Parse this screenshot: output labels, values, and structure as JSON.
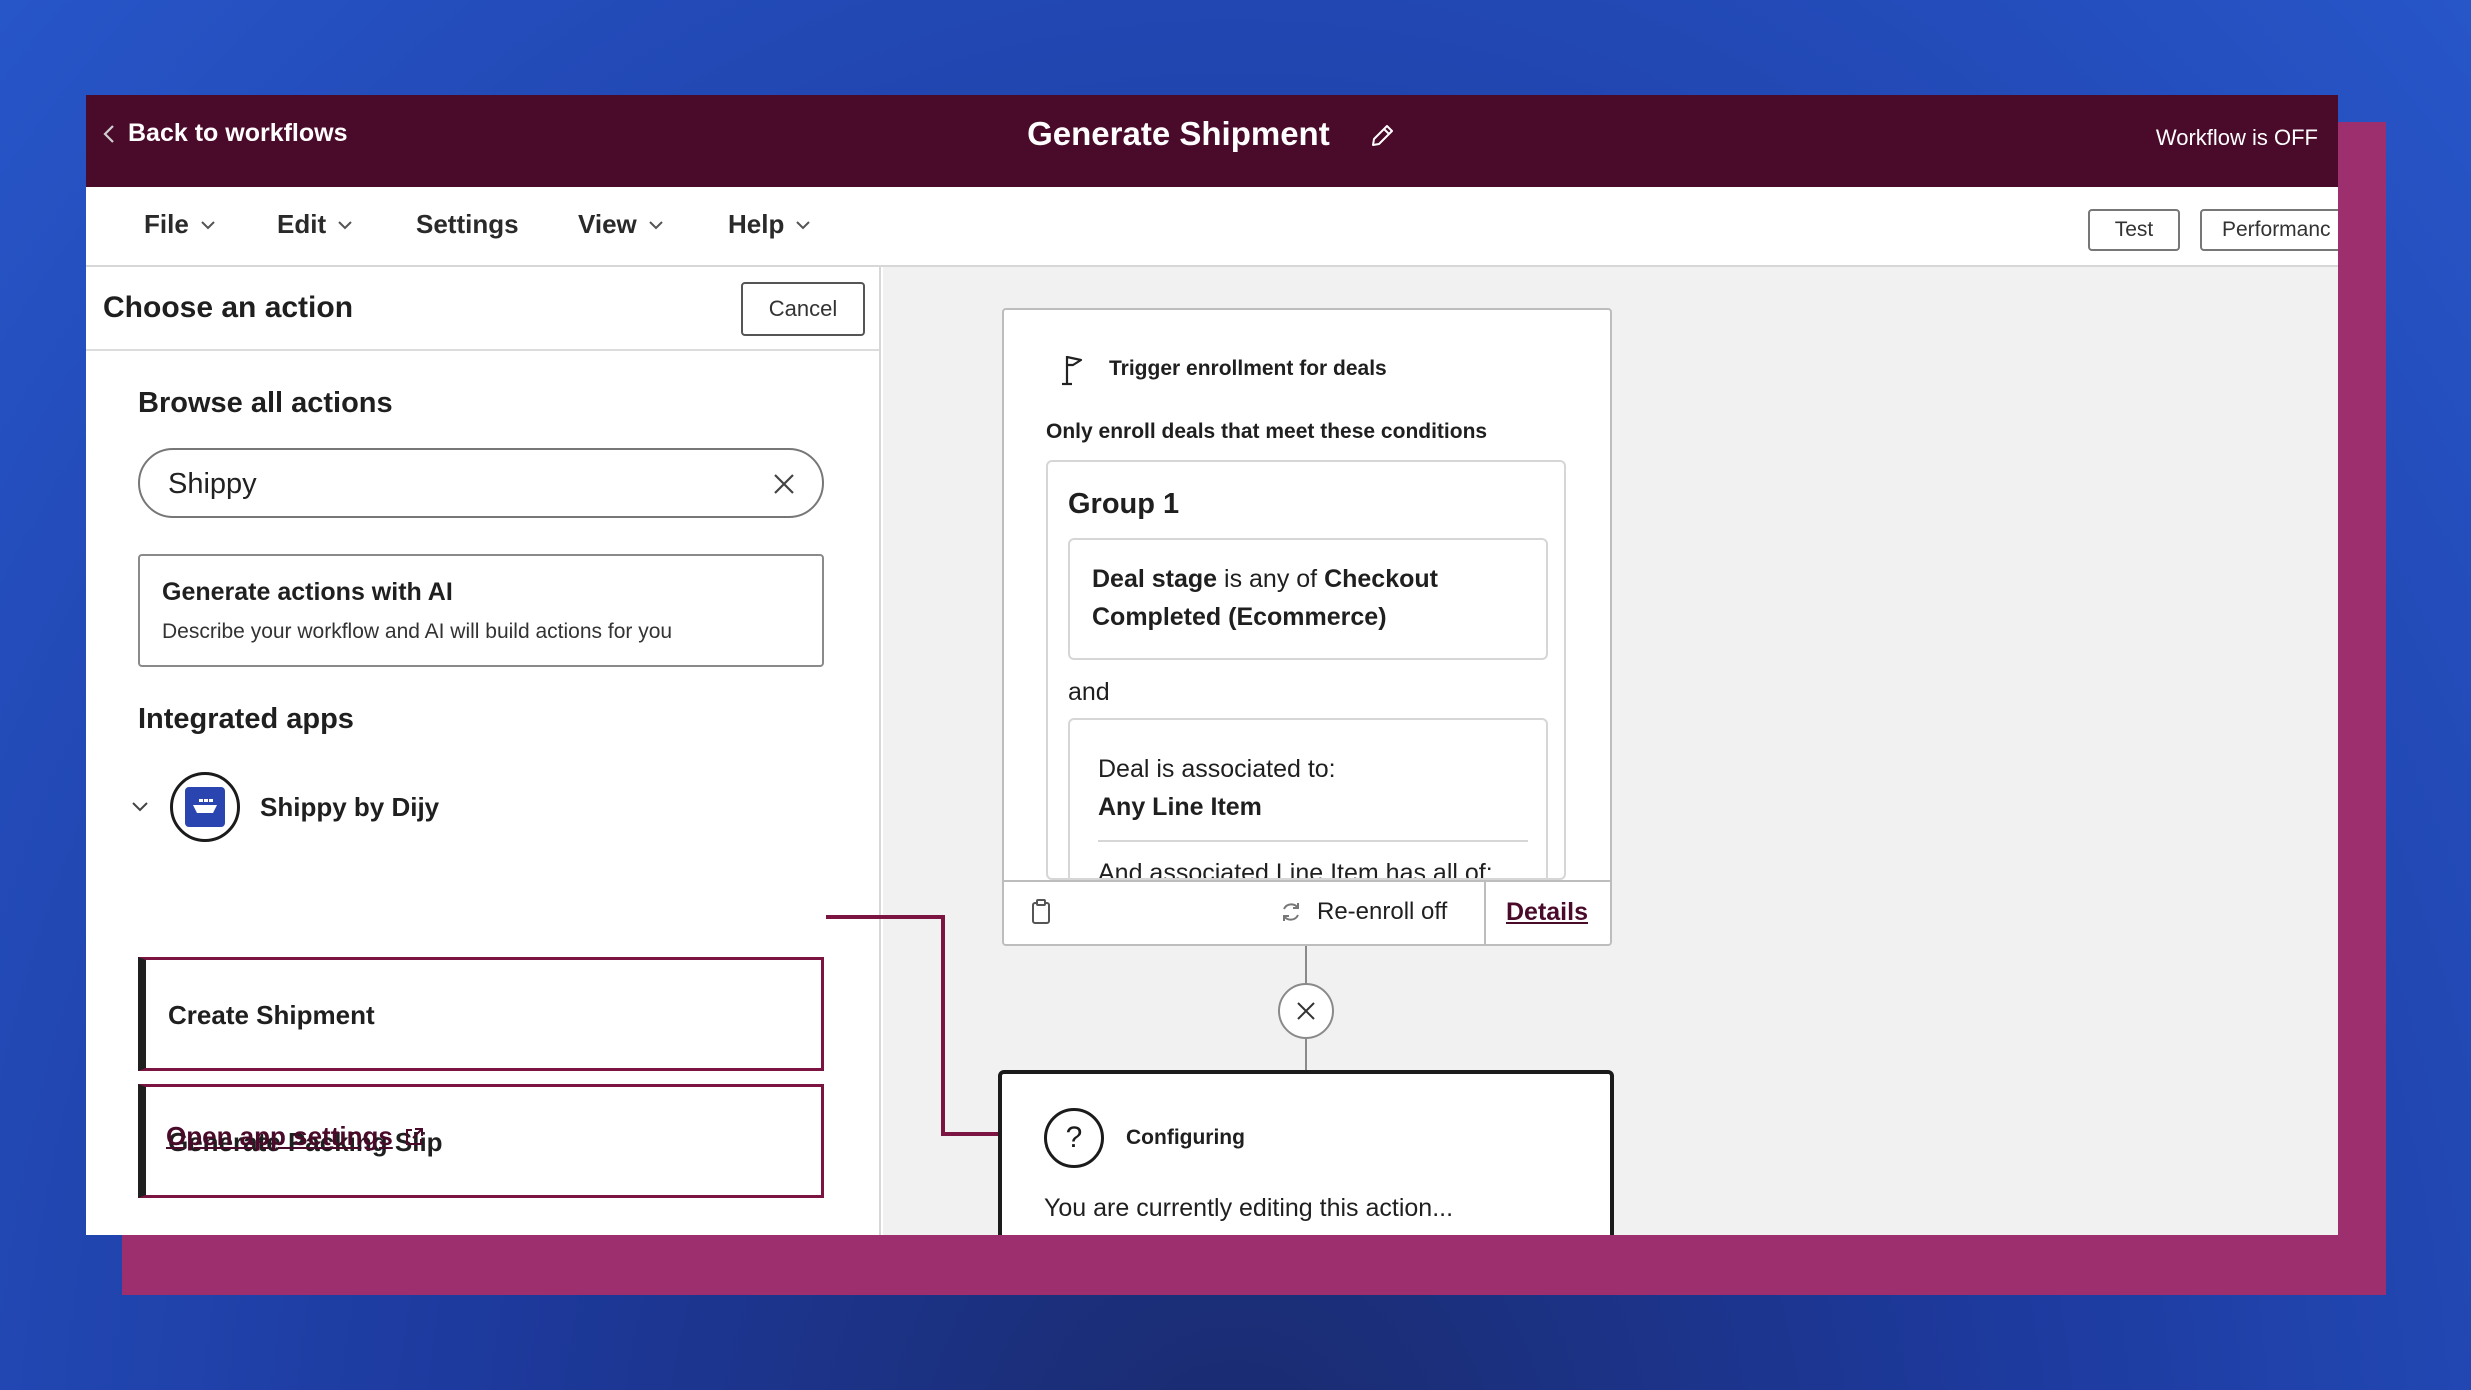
{
  "colors": {
    "brand_dark": "#4a0a2a",
    "accent_magenta": "#9d2f6f",
    "highlight_border": "#7b1440",
    "background_blue": "#2756c9"
  },
  "topbar": {
    "back_label": "Back to workflows",
    "title": "Generate Shipment",
    "status": "Workflow is OFF"
  },
  "menubar": {
    "items": [
      "File",
      "Edit",
      "Settings",
      "View",
      "Help"
    ],
    "test_label": "Test",
    "performance_label": "Performanc"
  },
  "left_panel": {
    "title": "Choose an action",
    "cancel_label": "Cancel",
    "browse_title": "Browse all actions",
    "search_value": "Shippy",
    "ai": {
      "title": "Generate actions with AI",
      "description": "Describe your workflow and AI will build actions for you"
    },
    "integrated_title": "Integrated apps",
    "app_name": "Shippy by Dijy",
    "actions": [
      "Create Shipment",
      "Generate Packing Slip"
    ],
    "app_settings_label": "Open app settings"
  },
  "trigger_card": {
    "heading": "Trigger enrollment for deals",
    "subheading": "Only enroll deals that meet these conditions",
    "group_title": "Group 1",
    "condition1": {
      "field": "Deal stage",
      "operator": " is any of ",
      "value_line1": "Checkout",
      "value_line2": "Completed (Ecommerce)"
    },
    "and_label": "and",
    "condition2": {
      "line1": "Deal is associated to:",
      "line2": "Any Line Item",
      "line3": "And associated Line Item has all of:"
    },
    "reenroll_label": "Re-enroll off",
    "details_label": "Details"
  },
  "config_card": {
    "title": "Configuring",
    "text": "You are currently editing this action..."
  }
}
